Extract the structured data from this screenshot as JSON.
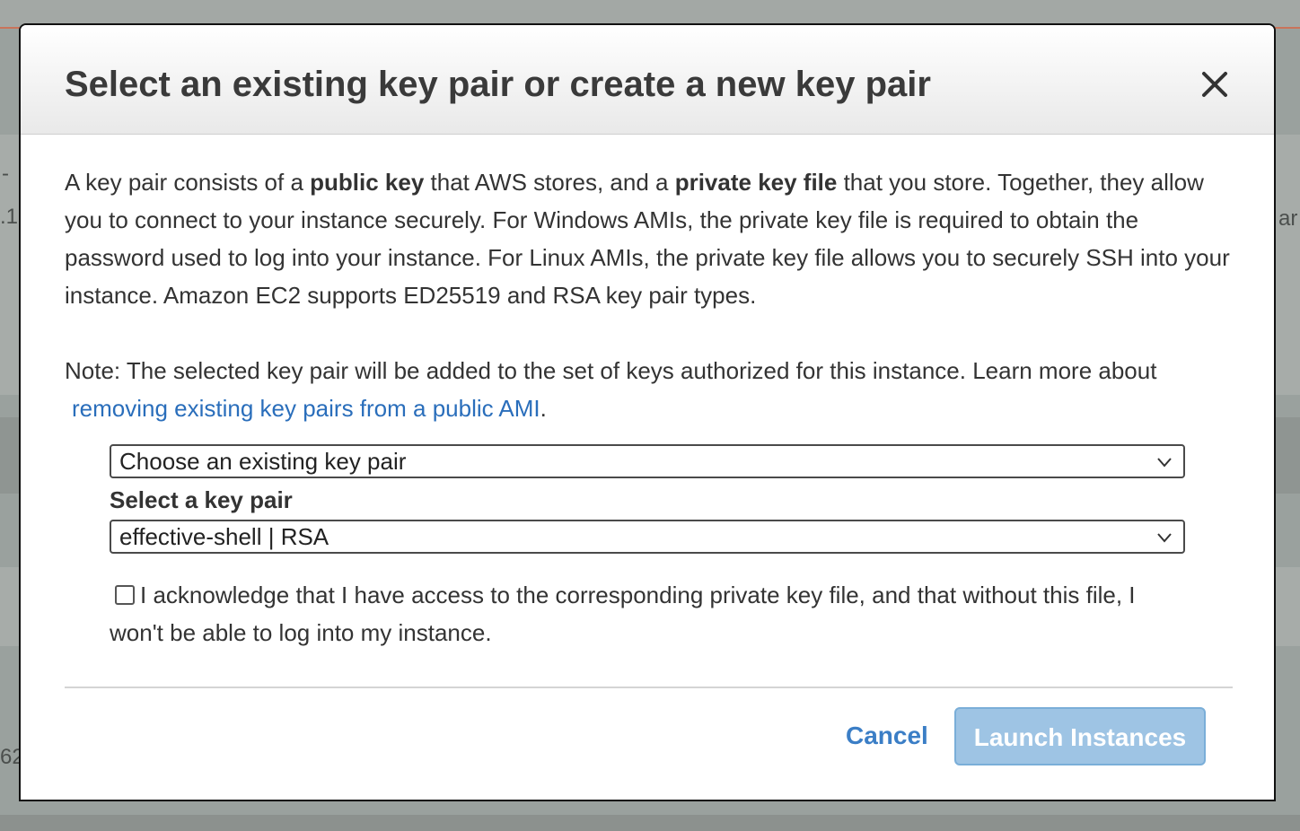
{
  "modal": {
    "title": "Select an existing key pair or create a new key pair",
    "close_icon": "close-icon"
  },
  "description": {
    "part1": "A key pair consists of a ",
    "bold1": "public key",
    "part2": " that AWS stores, and a ",
    "bold2": "private key file",
    "part3": " that you store. Together, they allow you to connect to your instance securely. For Windows AMIs, the private key file is required to obtain the password used to log into your instance. For Linux AMIs, the private key file allows you to securely SSH into your instance. Amazon EC2 supports ED25519 and RSA key pair types."
  },
  "note": {
    "text": "Note: The selected key pair will be added to the set of keys authorized for this instance. Learn more about",
    "link": "removing existing key pairs from a public AMI",
    "end": "."
  },
  "key_mode_select": {
    "value": "Choose an existing key pair"
  },
  "key_pair_select": {
    "label": "Select a key pair",
    "value": "effective-shell | RSA"
  },
  "acknowledge": {
    "text": "I acknowledge that I have access to the corresponding private key file, and that without this file, I won't be able to log into my instance.",
    "checked": false
  },
  "footer": {
    "cancel_label": "Cancel",
    "launch_label": "Launch Instances"
  },
  "background": {
    "fragments": [
      "-",
      ".1",
      "ar",
      "62"
    ]
  },
  "colors": {
    "link": "#2a6ebb",
    "primary_disabled": "#9ec4e4",
    "cancel": "#3b7ec6"
  }
}
